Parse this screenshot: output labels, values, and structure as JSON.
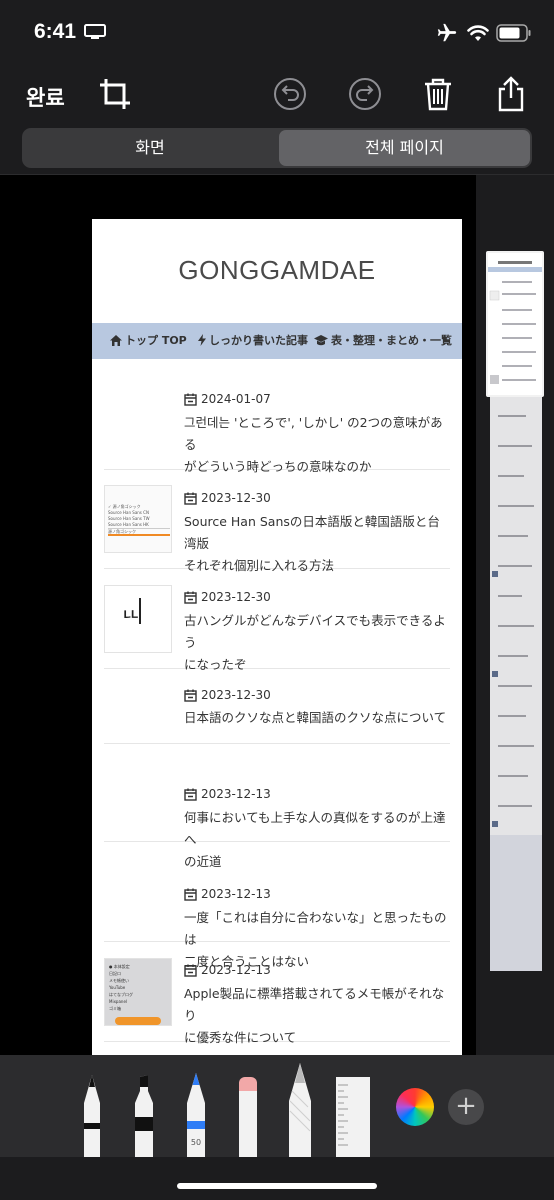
{
  "status": {
    "time": "6:41"
  },
  "toolbar": {
    "done_label": "완료"
  },
  "segment": {
    "screen_label": "화면",
    "full_page_label": "전체 페이지"
  },
  "page": {
    "site_title": "GONGGAMDAE",
    "nav": [
      {
        "label": "トップ TOP",
        "icon": "home-icon"
      },
      {
        "label": "しっかり書いた記事",
        "icon": "bolt-icon"
      },
      {
        "label": "表・整理・まとめ・一覧",
        "icon": "graduation-cap-icon"
      }
    ],
    "posts": [
      {
        "date": "2024-01-07",
        "line1": "그런데는 'ところで', 'しかし' の2つの意味がある",
        "line2": "がどういう時どっちの意味なのか"
      },
      {
        "date": "2023-12-30",
        "line1": "Source Han Sansの日本語版と韓国語版と台湾版",
        "line2": "それぞれ個別に入れる方法"
      },
      {
        "date": "2023-12-30",
        "line1": "古ハングルがどんなデバイスでも表示できるよう",
        "line2": "になったぞ"
      },
      {
        "date": "2023-12-30",
        "line1": "日本語のクソな点と韓国語のクソな点について",
        "line2": ""
      },
      {
        "date": "2023-12-13",
        "line1": "何事においても上手な人の真似をするのが上達へ",
        "line2": "の近道"
      },
      {
        "date": "2023-12-13",
        "line1": "一度「これは自分に合わないな」と思ったものは",
        "line2": "二度と合うことはない"
      },
      {
        "date": "2023-12-13",
        "line1": "Apple製品に標準搭載されてるメモ帳がそれなり",
        "line2": "に優秀な件について"
      }
    ],
    "thumb2_lines": [
      "✓ 源ノ角ゴシック",
      "Source Han Sans CN",
      "Source Han Sans TW",
      "Source Han Sans HK",
      "源ノ角ゴシック"
    ],
    "thumb3_glyph": "ᄔ",
    "thumb7_lines": [
      "● 本体設定",
      "日記ロ",
      "メモ帳使い",
      "YouTube",
      "はてなブログ",
      "Mixpanel",
      "ゴミ箱"
    ]
  },
  "tools": {
    "pencil_width": "50"
  }
}
